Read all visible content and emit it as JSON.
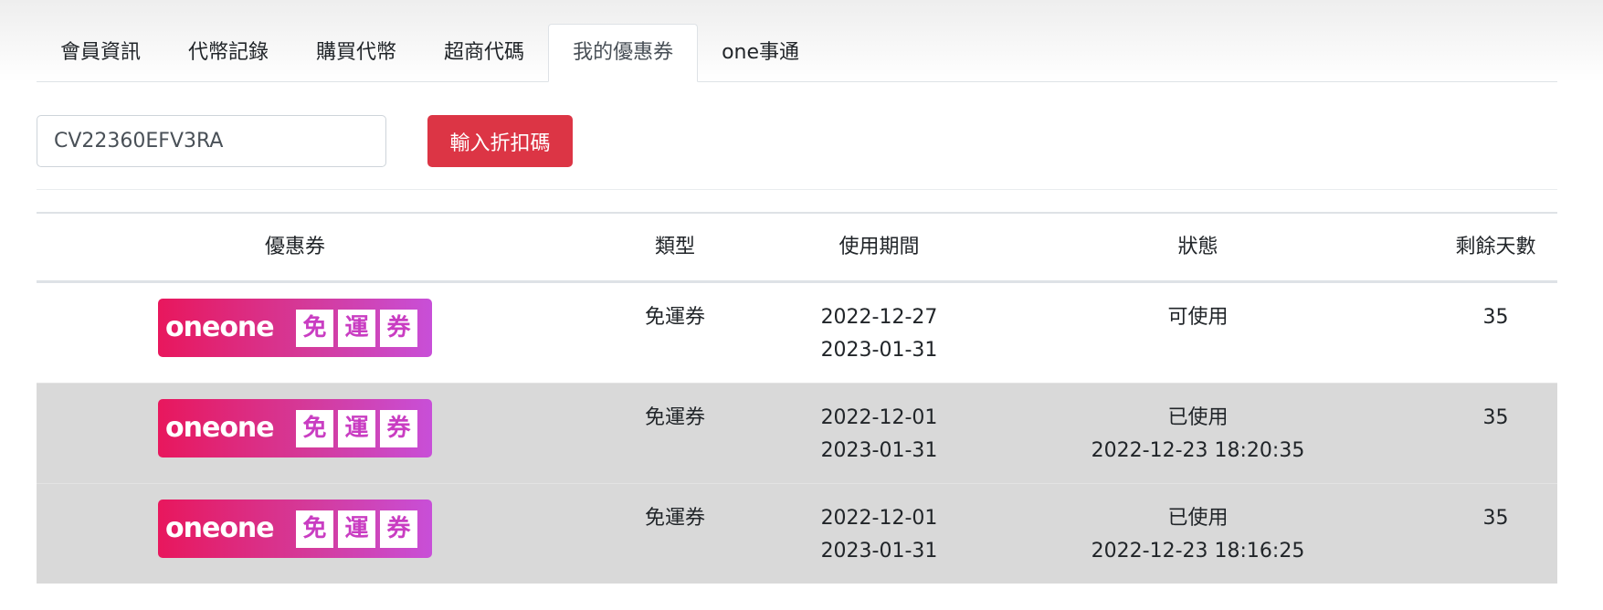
{
  "tabs": [
    {
      "label": "會員資訊",
      "active": false
    },
    {
      "label": "代幣記錄",
      "active": false
    },
    {
      "label": "購買代幣",
      "active": false
    },
    {
      "label": "超商代碼",
      "active": false
    },
    {
      "label": "我的優惠券",
      "active": true
    },
    {
      "label": "one事通",
      "active": false
    }
  ],
  "coupon_code": {
    "value": "CV22360EFV3RA",
    "button_label": "輸入折扣碼"
  },
  "table": {
    "headers": [
      "優惠券",
      "類型",
      "使用期間",
      "狀態",
      "剩餘天數"
    ],
    "badge": {
      "logo": "oneone",
      "chars": [
        "免",
        "運",
        "券"
      ],
      "colors": {
        "start": "#e8175d",
        "end": "#c84fd8"
      }
    },
    "rows": [
      {
        "type": "免運券",
        "start": "2022-12-27",
        "end": "2023-01-31",
        "status": "可使用",
        "status_time": "",
        "days_left": "35",
        "highlight": false
      },
      {
        "type": "免運券",
        "start": "2022-12-01",
        "end": "2023-01-31",
        "status": "已使用",
        "status_time": "2022-12-23 18:20:35",
        "days_left": "35",
        "highlight": true
      },
      {
        "type": "免運券",
        "start": "2022-12-01",
        "end": "2023-01-31",
        "status": "已使用",
        "status_time": "2022-12-23 18:16:25",
        "days_left": "35",
        "highlight": true
      }
    ]
  },
  "colors": {
    "primary_button": "#dc3545",
    "used_row_bg": "#d9d9d9"
  }
}
